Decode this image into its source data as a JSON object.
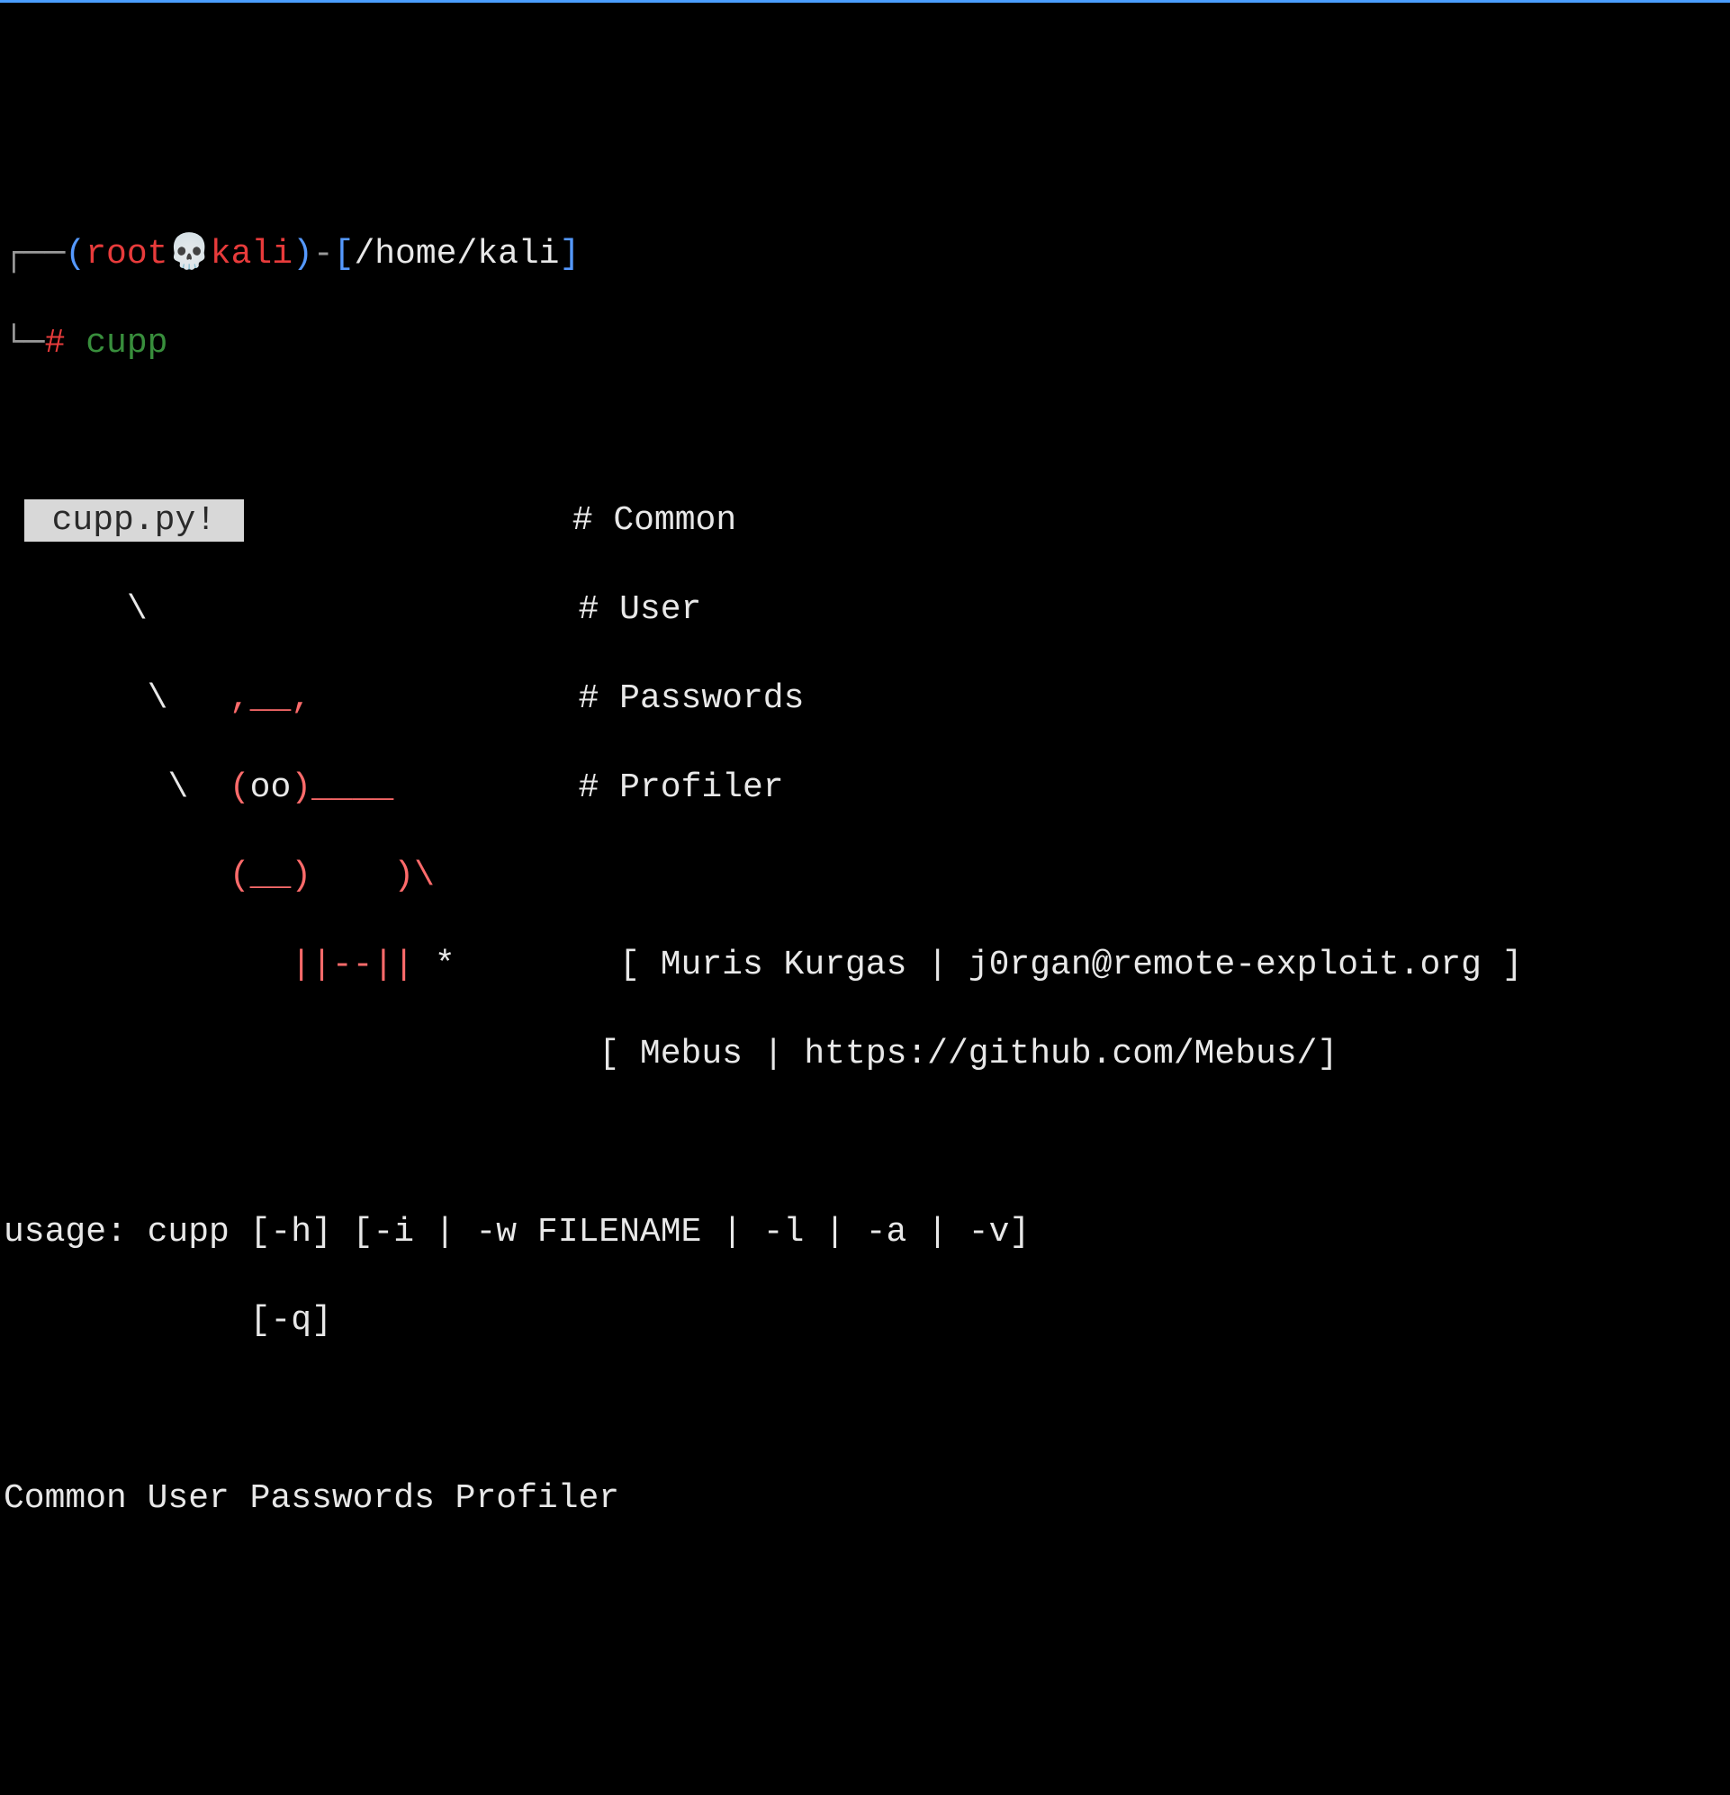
{
  "prompt": {
    "corner_top": "┌──",
    "corner_bottom": "└─",
    "paren_open": "(",
    "paren_close": ")",
    "user": "root",
    "skull": "💀",
    "host": "kali",
    "dash": "-",
    "bracket_open": "[",
    "bracket_close": "]",
    "path": "/home/kali",
    "hash": "#",
    "command": "cupp"
  },
  "banner": {
    "title": " cupp.py! ",
    "acronym": [
      "# Common",
      "# User",
      "# Passwords",
      "# Profiler"
    ],
    "ascii": {
      "l1": "      \\                     ",
      "l2": "       \\   ",
      "l2b": ",__,",
      "l2c": "             ",
      "l3": "        \\  ",
      "l3b": "(",
      "l3c": "oo",
      "l3d": ")____",
      "l3e": "         ",
      "l4a": "           ",
      "l4b": "(__)    )\\",
      "l4c": "        ",
      "l5a": "              ",
      "l5b": "||--||",
      "l5c": " *       "
    },
    "author1": " [ Muris Kurgas | j0rgan@remote-exploit.org ]",
    "author2_prefix": "                            ",
    "author2": " [ Mebus | https://github.com/Mebus/]"
  },
  "usage": {
    "line1": "usage: cupp [-h] [-i | -w FILENAME | -l | -a | -v]",
    "line2": "            [-q]"
  },
  "description": "Common User Passwords Profiler"
}
